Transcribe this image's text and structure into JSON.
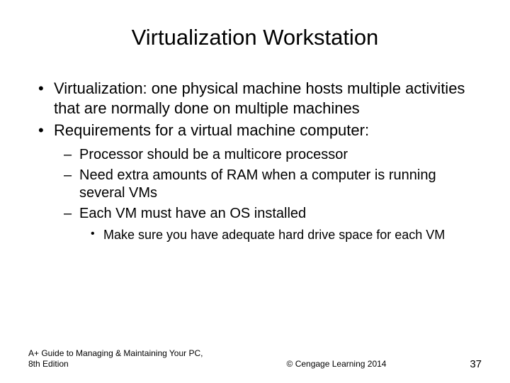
{
  "title": "Virtualization Workstation",
  "bullets": {
    "b1": "Virtualization: one physical machine hosts multiple activities that are normally done on multiple machines",
    "b2": "Requirements for a virtual machine computer:",
    "b2_1": "Processor should be a multicore processor",
    "b2_2": "Need extra amounts of RAM when a computer is running several VMs",
    "b2_3": "Each VM must have an OS installed",
    "b2_3_1": "Make sure you have adequate hard drive space for each VM"
  },
  "footer": {
    "left": "A+ Guide to Managing & Maintaining Your PC, 8th Edition",
    "center": "© Cengage Learning  2014",
    "page": "37"
  }
}
